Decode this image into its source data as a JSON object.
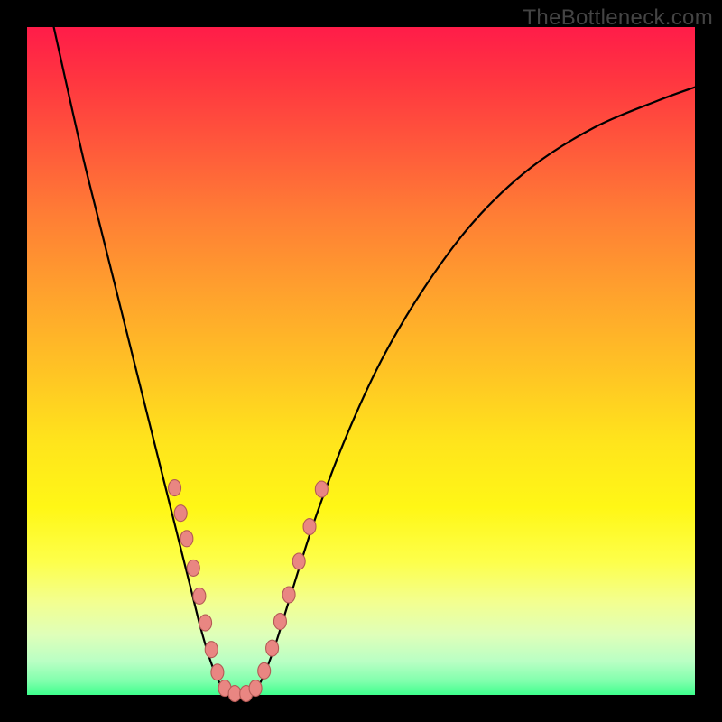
{
  "watermark": "TheBottleneck.com",
  "chart_data": {
    "type": "line",
    "title": "",
    "xlabel": "",
    "ylabel": "",
    "x_domain": [
      0,
      1
    ],
    "ylim": [
      0,
      1
    ],
    "curve": {
      "comment": "V-shaped bottleneck curve. x is normalized horizontal position, y is normalized height (0 = bottom/green/optimal, 1 = top/red/bottleneck).",
      "left": [
        {
          "x": 0.04,
          "y": 1.0
        },
        {
          "x": 0.06,
          "y": 0.91
        },
        {
          "x": 0.085,
          "y": 0.8
        },
        {
          "x": 0.11,
          "y": 0.7
        },
        {
          "x": 0.135,
          "y": 0.6
        },
        {
          "x": 0.16,
          "y": 0.5
        },
        {
          "x": 0.185,
          "y": 0.4
        },
        {
          "x": 0.205,
          "y": 0.32
        },
        {
          "x": 0.225,
          "y": 0.24
        },
        {
          "x": 0.245,
          "y": 0.16
        },
        {
          "x": 0.26,
          "y": 0.1
        },
        {
          "x": 0.275,
          "y": 0.05
        },
        {
          "x": 0.29,
          "y": 0.015
        },
        {
          "x": 0.305,
          "y": 0.0
        }
      ],
      "right": [
        {
          "x": 0.335,
          "y": 0.0
        },
        {
          "x": 0.35,
          "y": 0.02
        },
        {
          "x": 0.37,
          "y": 0.07
        },
        {
          "x": 0.395,
          "y": 0.15
        },
        {
          "x": 0.43,
          "y": 0.26
        },
        {
          "x": 0.475,
          "y": 0.38
        },
        {
          "x": 0.53,
          "y": 0.5
        },
        {
          "x": 0.595,
          "y": 0.61
        },
        {
          "x": 0.67,
          "y": 0.71
        },
        {
          "x": 0.755,
          "y": 0.79
        },
        {
          "x": 0.85,
          "y": 0.85
        },
        {
          "x": 0.945,
          "y": 0.89
        },
        {
          "x": 1.0,
          "y": 0.91
        }
      ]
    },
    "markers": {
      "comment": "Salmon oval markers along the lower portion of both curve arms, approximate normalized (x, y) positions.",
      "points": [
        {
          "x": 0.221,
          "y": 0.31
        },
        {
          "x": 0.23,
          "y": 0.272
        },
        {
          "x": 0.239,
          "y": 0.234
        },
        {
          "x": 0.249,
          "y": 0.19
        },
        {
          "x": 0.258,
          "y": 0.148
        },
        {
          "x": 0.267,
          "y": 0.108
        },
        {
          "x": 0.276,
          "y": 0.068
        },
        {
          "x": 0.285,
          "y": 0.034
        },
        {
          "x": 0.296,
          "y": 0.01
        },
        {
          "x": 0.311,
          "y": 0.002
        },
        {
          "x": 0.328,
          "y": 0.002
        },
        {
          "x": 0.342,
          "y": 0.01
        },
        {
          "x": 0.355,
          "y": 0.036
        },
        {
          "x": 0.367,
          "y": 0.07
        },
        {
          "x": 0.379,
          "y": 0.11
        },
        {
          "x": 0.392,
          "y": 0.15
        },
        {
          "x": 0.407,
          "y": 0.2
        },
        {
          "x": 0.423,
          "y": 0.252
        },
        {
          "x": 0.441,
          "y": 0.308
        }
      ],
      "rx": 7.0,
      "ry": 9.0
    }
  }
}
